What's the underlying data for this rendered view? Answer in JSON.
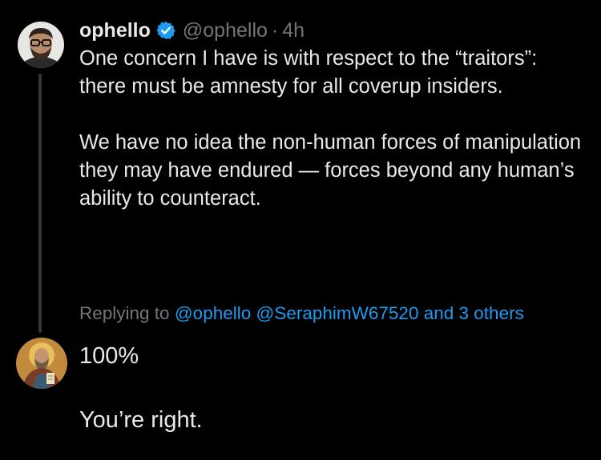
{
  "original_tweet": {
    "display_name": "ophello",
    "handle": "@ophello",
    "separator": "·",
    "time": "4h",
    "verified_color": "#1d9bf0",
    "avatar_icon": "bearded-man-glasses-avatar",
    "paragraphs": [
      "One concern I have is with respect to the “traitors”: there must be amnesty for all coverup insiders.",
      "We have no idea the non-human forces of manipulation they may have endured — forces beyond any human’s ability to counteract."
    ]
  },
  "reply": {
    "replying_to_prefix": "Replying to",
    "mentions": [
      "@ophello",
      "@SeraphimW67520",
      "and 3 others"
    ],
    "avatar_icon": "icon-saint-avatar",
    "paragraphs": [
      "100%",
      "You’re right."
    ]
  },
  "colors": {
    "background": "#000000",
    "text": "#e7e9ea",
    "secondary": "#71767b",
    "link": "#1d9bf0",
    "thread_line": "#333639"
  }
}
